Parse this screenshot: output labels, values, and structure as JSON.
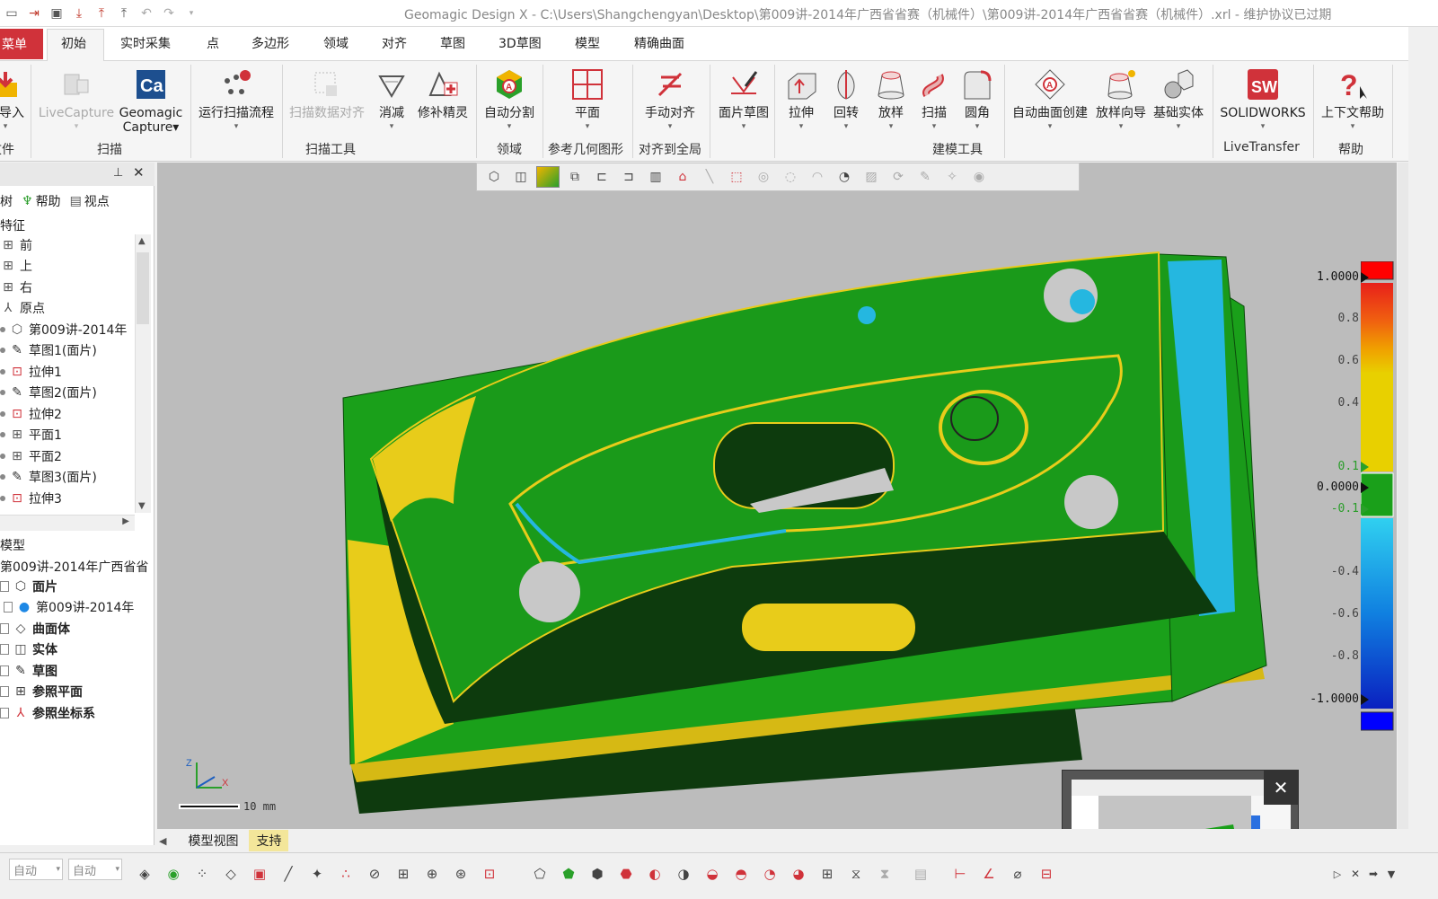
{
  "window": {
    "title": "Geomagic Design X - C:\\Users\\Shangchengyan\\Desktop\\第009讲-2014年广西省省赛（机械件）\\第009讲-2014年广西省省赛（机械件）.xrl - 维护协议已过期"
  },
  "tabs": {
    "menu": "菜单",
    "items": [
      "初始",
      "实时采集",
      "点",
      "多边形",
      "领域",
      "对齐",
      "草图",
      "3D草图",
      "模型",
      "精确曲面"
    ]
  },
  "ribbon": {
    "buttons": [
      {
        "label": "导入",
        "icon": "import-icon"
      },
      {
        "label": "LiveCapture",
        "icon": "livecapture-icon",
        "disabled": true
      },
      {
        "label": "Geomagic\nCapture",
        "icon": "capture-icon"
      },
      {
        "label": "运行扫描流程",
        "icon": "scan-flow-icon"
      },
      {
        "label": "扫描数据对齐",
        "icon": "scan-align-icon",
        "disabled": true
      },
      {
        "label": "消减",
        "icon": "decimate-icon"
      },
      {
        "label": "修补精灵",
        "icon": "healing-wizard-icon"
      },
      {
        "label": "自动分割",
        "icon": "auto-segment-icon"
      },
      {
        "label": "平面",
        "icon": "plane-icon"
      },
      {
        "label": "手动对齐",
        "icon": "manual-align-icon"
      },
      {
        "label": "面片草图",
        "icon": "mesh-sketch-icon"
      },
      {
        "label": "拉伸",
        "icon": "extrude-icon"
      },
      {
        "label": "回转",
        "icon": "revolve-icon"
      },
      {
        "label": "放样",
        "icon": "loft-icon"
      },
      {
        "label": "扫描",
        "icon": "sweep-icon"
      },
      {
        "label": "圆角",
        "icon": "fillet-icon"
      },
      {
        "label": "自动曲面创建",
        "icon": "auto-surface-icon"
      },
      {
        "label": "放样向导",
        "icon": "loft-wizard-icon"
      },
      {
        "label": "基础实体",
        "icon": "basic-solid-icon"
      },
      {
        "label": "SOLIDWORKS",
        "icon": "solidworks-icon"
      },
      {
        "label": "上下文帮助",
        "icon": "context-help-icon"
      }
    ],
    "groups": [
      "文件",
      "扫描",
      "扫描工具",
      "领域",
      "参考几何图形",
      "对齐到全局",
      "建模工具",
      "LiveTransfer",
      "帮助"
    ]
  },
  "left_panel": {
    "tabs": [
      "树",
      "帮助",
      "视点"
    ],
    "feature_title": "特征",
    "feature_tree": [
      {
        "label": "前",
        "icon": "plane-icon"
      },
      {
        "label": "上",
        "icon": "plane-icon"
      },
      {
        "label": "右",
        "icon": "plane-icon"
      },
      {
        "label": "原点",
        "icon": "origin-icon"
      },
      {
        "label": "第009讲-2014年",
        "icon": "mesh-icon"
      },
      {
        "label": "草图1(面片)",
        "icon": "sketch-icon"
      },
      {
        "label": "拉伸1",
        "icon": "extrude-icon"
      },
      {
        "label": "草图2(面片)",
        "icon": "sketch-icon"
      },
      {
        "label": "拉伸2",
        "icon": "extrude-icon"
      },
      {
        "label": "平面1",
        "icon": "plane-icon"
      },
      {
        "label": "平面2",
        "icon": "plane-icon"
      },
      {
        "label": "草图3(面片)",
        "icon": "sketch-icon"
      },
      {
        "label": "拉伸3",
        "icon": "extrude-icon"
      }
    ],
    "model_title": "模型",
    "model_root": "第009讲-2014年广西省省",
    "model_tree": [
      {
        "label": "面片",
        "icon": "mesh-icon",
        "bold": true
      },
      {
        "label": "第009讲-2014年",
        "icon": "mesh-dot-icon",
        "bold": false
      },
      {
        "label": "曲面体",
        "icon": "surface-icon",
        "bold": true
      },
      {
        "label": "实体",
        "icon": "solid-icon",
        "bold": true
      },
      {
        "label": "草图",
        "icon": "sketch-icon",
        "bold": true
      },
      {
        "label": "参照平面",
        "icon": "plane-icon",
        "bold": true
      },
      {
        "label": "参照坐标系",
        "icon": "coord-icon",
        "bold": true
      }
    ]
  },
  "viewport": {
    "scale_label": "10 mm",
    "legend": {
      "labels": [
        "1.0000",
        "0.8",
        "0.6",
        "0.4",
        "0.1",
        "0.0000",
        "-0.1",
        "-0.4",
        "-0.6",
        "-0.8",
        "-1.0000"
      ],
      "values": [
        1.0,
        0.8,
        0.6,
        0.4,
        0.1,
        0.0,
        -0.1,
        -0.4,
        -0.6,
        -0.8,
        -1.0
      ]
    },
    "axis": {
      "x": "X",
      "z": "Z"
    }
  },
  "bottom": {
    "tabs": [
      "模型视图",
      "支持"
    ],
    "combo1": "自动",
    "combo2": "自动"
  },
  "colors": {
    "menu_red": "#d0323a",
    "model_green": "#1a9a1a",
    "dark_green": "#0d3b0d",
    "yellow": "#e8cc1a",
    "cyan": "#25b7e0"
  }
}
